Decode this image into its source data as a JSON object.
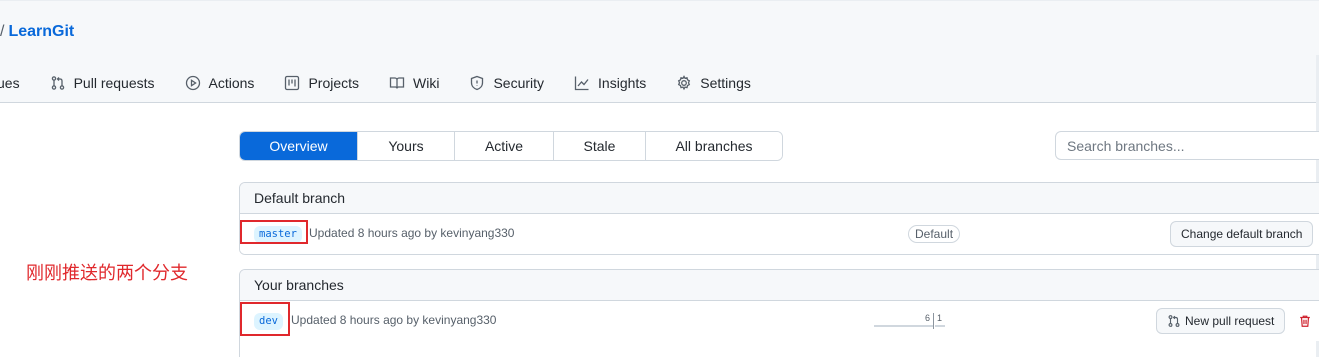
{
  "repo": {
    "separator": "/",
    "name": "LearnGit"
  },
  "nav": [
    {
      "label": "ues",
      "icon": "issue-icon"
    },
    {
      "label": "Pull requests",
      "icon": "pull-request-icon"
    },
    {
      "label": "Actions",
      "icon": "play-icon"
    },
    {
      "label": "Projects",
      "icon": "project-icon"
    },
    {
      "label": "Wiki",
      "icon": "book-icon"
    },
    {
      "label": "Security",
      "icon": "shield-icon"
    },
    {
      "label": "Insights",
      "icon": "graph-icon"
    },
    {
      "label": "Settings",
      "icon": "gear-icon"
    }
  ],
  "tabs": [
    "Overview",
    "Yours",
    "Active",
    "Stale",
    "All branches"
  ],
  "active_tab": "Overview",
  "search": {
    "placeholder": "Search branches..."
  },
  "default_section": {
    "title": "Default branch",
    "branch": "master",
    "updated": "Updated 8 hours ago by kevinyang330",
    "label": "Default",
    "button": "Change default branch"
  },
  "your_section": {
    "title": "Your branches",
    "branch": "dev",
    "updated": "Updated 8 hours ago by kevinyang330",
    "behind": "6",
    "ahead": "1",
    "button": "New pull request"
  },
  "annotation": {
    "text": "刚刚推送的两个分支",
    "color": "#e0282c"
  },
  "colors": {
    "accent": "#0969da",
    "danger": "#cf222e",
    "annotation": "#e0282c"
  }
}
